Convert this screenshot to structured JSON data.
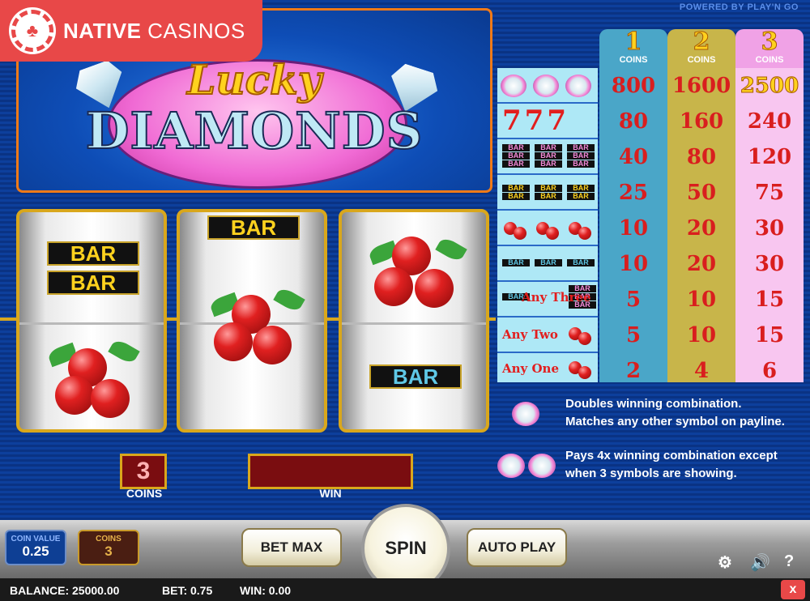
{
  "watermark": {
    "brand_bold": "NATIVE",
    "brand_rest": " CASINOS",
    "chip_icon": "maple-leaf-icon"
  },
  "powered_by": "POWERED BY PLAY'N GO",
  "logo": {
    "line1": "Lucky",
    "line2": "DIAMONDS"
  },
  "reels": [
    {
      "top": "BAR BAR",
      "bottom": "cherry"
    },
    {
      "top": "BAR",
      "middle": "cherry"
    },
    {
      "top": "cherry",
      "bottom": "BAR"
    }
  ],
  "reel_text": {
    "bar": "BAR"
  },
  "coins_display": {
    "value": "3",
    "label": "COINS"
  },
  "win_display": {
    "value": "",
    "label": "WIN"
  },
  "paytable": {
    "headers": [
      {
        "num": "1",
        "label": "COINS",
        "color": "#4aa6c8"
      },
      {
        "num": "2",
        "label": "COINS",
        "color": "#c8b54a"
      },
      {
        "num": "3",
        "label": "COINS",
        "color": "#f0a2e6"
      }
    ],
    "rows": [
      {
        "symbol": "3 diamonds",
        "pays": [
          "800",
          "1600",
          "2500"
        ]
      },
      {
        "symbol": "777",
        "pays": [
          "80",
          "160",
          "240"
        ]
      },
      {
        "symbol": "3 triple bar",
        "pays": [
          "40",
          "80",
          "120"
        ]
      },
      {
        "symbol": "3 double bar",
        "pays": [
          "25",
          "50",
          "75"
        ]
      },
      {
        "symbol": "3 cherries",
        "pays": [
          "10",
          "20",
          "30"
        ]
      },
      {
        "symbol": "3 single bar",
        "pays": [
          "10",
          "20",
          "30"
        ]
      },
      {
        "symbol": "Any Three",
        "pays": [
          "5",
          "10",
          "15"
        ]
      },
      {
        "symbol": "Any Two",
        "pays": [
          "5",
          "10",
          "15"
        ]
      },
      {
        "symbol": "Any One",
        "pays": [
          "2",
          "4",
          "6"
        ]
      }
    ],
    "any_three": "Any Three",
    "any_two": "Any Two",
    "any_one": "Any One",
    "seven": "777",
    "bar_mini": "BAR"
  },
  "info": [
    {
      "line1": "Doubles winning combination.",
      "line2": "Matches any other symbol on payline."
    },
    {
      "line1": "Pays 4x winning combination except",
      "line2": "when 3 symbols are showing."
    }
  ],
  "controls": {
    "coin_value_label": "COIN VALUE",
    "coin_value": "0.25",
    "coins_label": "COINS",
    "coins_value": "3",
    "bet_max": "BET MAX",
    "spin": "SPIN",
    "auto_play": "AUTO PLAY",
    "settings_icon": "gear-icon",
    "sound_icon": "speaker-icon",
    "help": "?",
    "close": "x"
  },
  "status": {
    "balance": "BALANCE: 25000.00",
    "bet": "BET: 0.75",
    "win": "WIN: 0.00"
  }
}
